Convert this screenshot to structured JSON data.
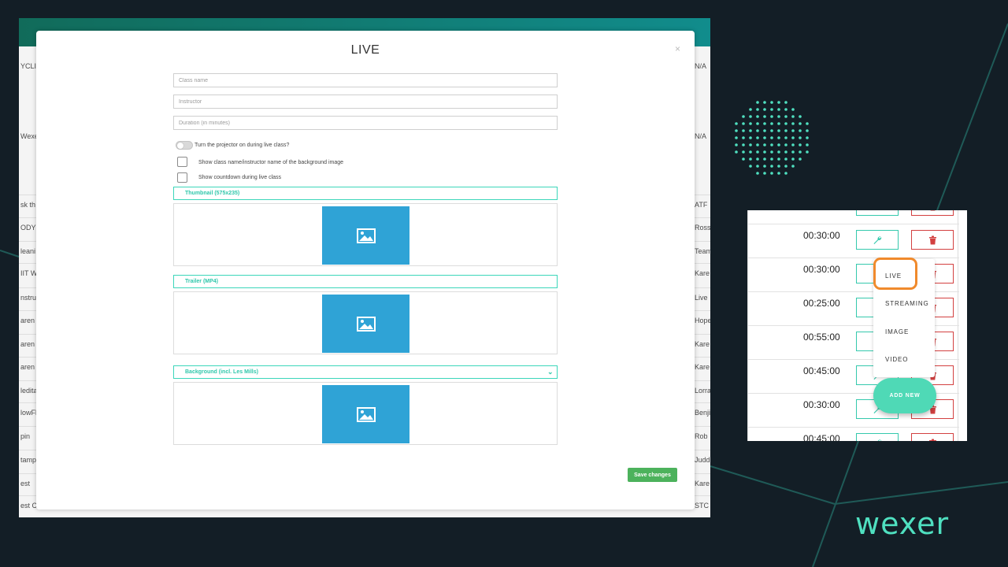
{
  "background": {
    "table_left_fragments": [
      "YCLI",
      "Wexer",
      "sk th",
      "ODY",
      "leani",
      "IIT W",
      "nstruc",
      "aren",
      "aren",
      "aren",
      "leditat",
      "lowFl",
      "pin",
      "tamp",
      "est",
      "est C"
    ],
    "table_right_fragments": [
      "N/A",
      "N/A",
      "ATF",
      "Ross",
      "Team",
      "Kare",
      "Live",
      "Hope",
      "Kare",
      "Kare",
      "Lorra",
      "Benji",
      "Rob",
      "Judd",
      "Kare",
      "STC"
    ]
  },
  "modal": {
    "title": "LIVE",
    "close": "×",
    "fields": {
      "class_name_placeholder": "Class name",
      "instructor_placeholder": "Instructor",
      "duration_placeholder": "Duration (in minutes)"
    },
    "projector_toggle_label": "Turn the projector on during live class?",
    "checkbox_show_name_label": "Show class name/instructor name of the background image",
    "checkbox_countdown_label": "Show countdown during live class",
    "sections": {
      "thumbnail": "Thumbnail (575x235)",
      "trailer": "Trailer (MP4)",
      "background": "Background (incl. Les Mills)"
    },
    "save_label": "Save changes"
  },
  "panel": {
    "durations": [
      "00:30:00",
      "00:30:00",
      "00:25:00",
      "00:55:00",
      "00:45:00",
      "00:30:00",
      "00:45:00"
    ],
    "menu": {
      "items": [
        "LIVE",
        "STREAMING",
        "IMAGE",
        "VIDEO"
      ],
      "highlighted": "LIVE"
    },
    "add_new_label": "ADD NEW"
  },
  "brand": {
    "logo_text": "wexer",
    "accent": "#4fe0c0",
    "image_placeholder_color": "#2fa3d6",
    "save_color": "#4cb25c",
    "highlight_color": "#f08a2c",
    "delete_color": "#d34040"
  },
  "icons": {
    "image_placeholder": "image-icon",
    "edit": "wrench-icon",
    "delete": "trash-icon",
    "dropdown": "chevron-down-icon"
  }
}
